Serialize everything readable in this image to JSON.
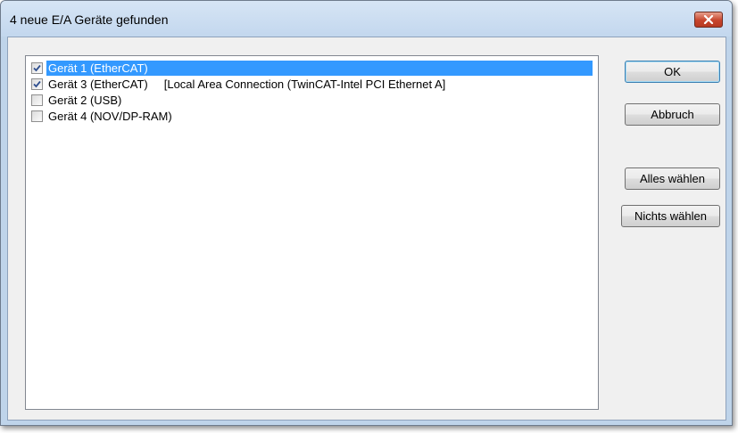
{
  "window": {
    "title": "4 neue E/A Geräte gefunden",
    "close_icon": "close-icon"
  },
  "devices": [
    {
      "label": "Gerät 1 (EtherCAT)",
      "detail": "",
      "checked": true,
      "selected": true
    },
    {
      "label": "Gerät 3 (EtherCAT)",
      "detail": "[Local Area Connection (TwinCAT-Intel PCI Ethernet A]",
      "checked": true,
      "selected": false
    },
    {
      "label": "Gerät 2 (USB)",
      "detail": "",
      "checked": false,
      "selected": false
    },
    {
      "label": "Gerät 4 (NOV/DP-RAM)",
      "detail": "",
      "checked": false,
      "selected": false
    }
  ],
  "buttons": {
    "ok": "OK",
    "cancel": "Abbruch",
    "select_all": "Alles wählen",
    "select_none": "Nichts wählen"
  },
  "colors": {
    "selection": "#3399ff",
    "close_button": "#c7452d"
  }
}
